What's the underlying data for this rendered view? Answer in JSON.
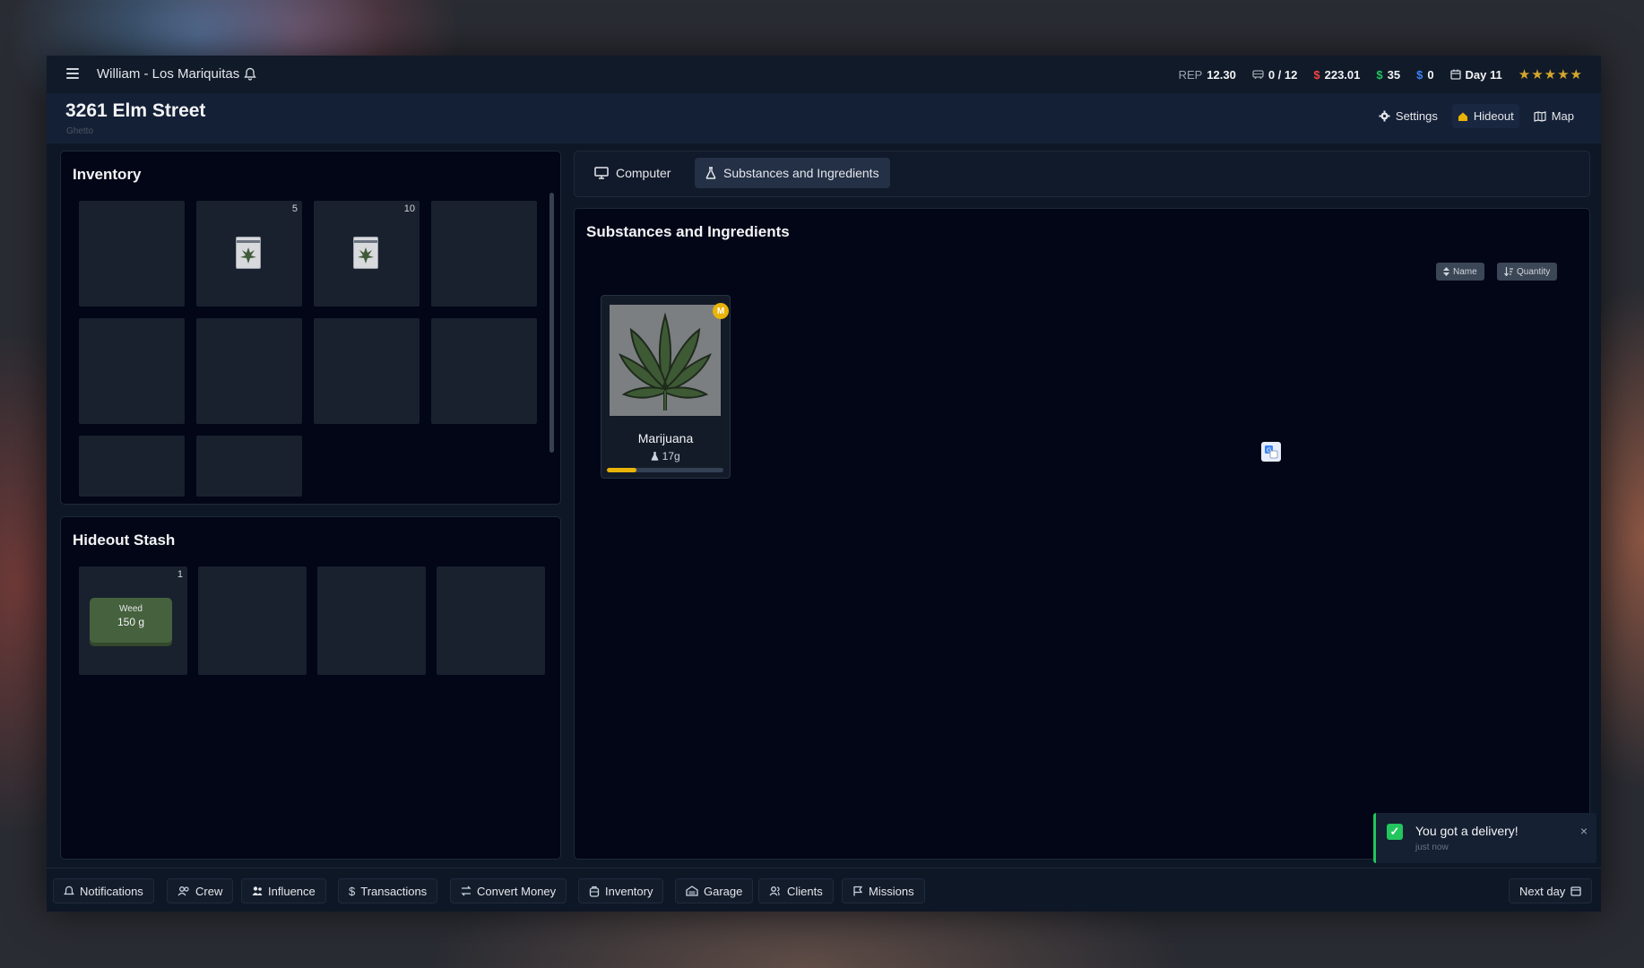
{
  "topbar": {
    "player": "William - Los Mariquitas",
    "rep_label": "REP",
    "rep_value": "12.30",
    "capacity": "0 / 12",
    "cash": "223.01",
    "clean_money": "35",
    "bank": "0",
    "day": "Day 11",
    "stars": "★★★★★"
  },
  "location": {
    "address": "3261 Elm Street",
    "district": "Ghetto"
  },
  "header_nav": {
    "settings": "Settings",
    "hideout": "Hideout",
    "map": "Map"
  },
  "inventory": {
    "title": "Inventory",
    "slots": [
      {
        "qty": ""
      },
      {
        "qty": "5",
        "item": "baggie"
      },
      {
        "qty": "10",
        "item": "baggie"
      },
      {
        "qty": ""
      },
      {
        "qty": ""
      },
      {
        "qty": ""
      },
      {
        "qty": ""
      },
      {
        "qty": ""
      },
      {
        "qty": ""
      },
      {
        "qty": ""
      }
    ]
  },
  "stash": {
    "title": "Hideout Stash",
    "slot1_qty": "1",
    "brick_label": "Weed",
    "brick_weight": "150 g"
  },
  "tabs": {
    "computer": "Computer",
    "substances": "Substances and Ingredients"
  },
  "substances": {
    "title": "Substances and Ingredients",
    "sort_name": "Name",
    "sort_quantity": "Quantity",
    "items": [
      {
        "name": "Marijuana",
        "weight": "17g",
        "badge": "M",
        "progress": 0.25
      }
    ]
  },
  "toast": {
    "message": "You got a delivery!",
    "time": "just now",
    "close": "×"
  },
  "bottom_nav": {
    "notifications": "Notifications",
    "crew": "Crew",
    "influence": "Influence",
    "transactions": "Transactions",
    "convert_money": "Convert Money",
    "inventory": "Inventory",
    "garage": "Garage",
    "clients": "Clients",
    "missions": "Missions",
    "next_day": "Next day"
  },
  "colors": {
    "accent_yellow": "#eab308",
    "cash_red": "#ef4444",
    "money_green": "#22c55e",
    "bank_blue": "#3b82f6",
    "panel_bg": "#020617"
  }
}
